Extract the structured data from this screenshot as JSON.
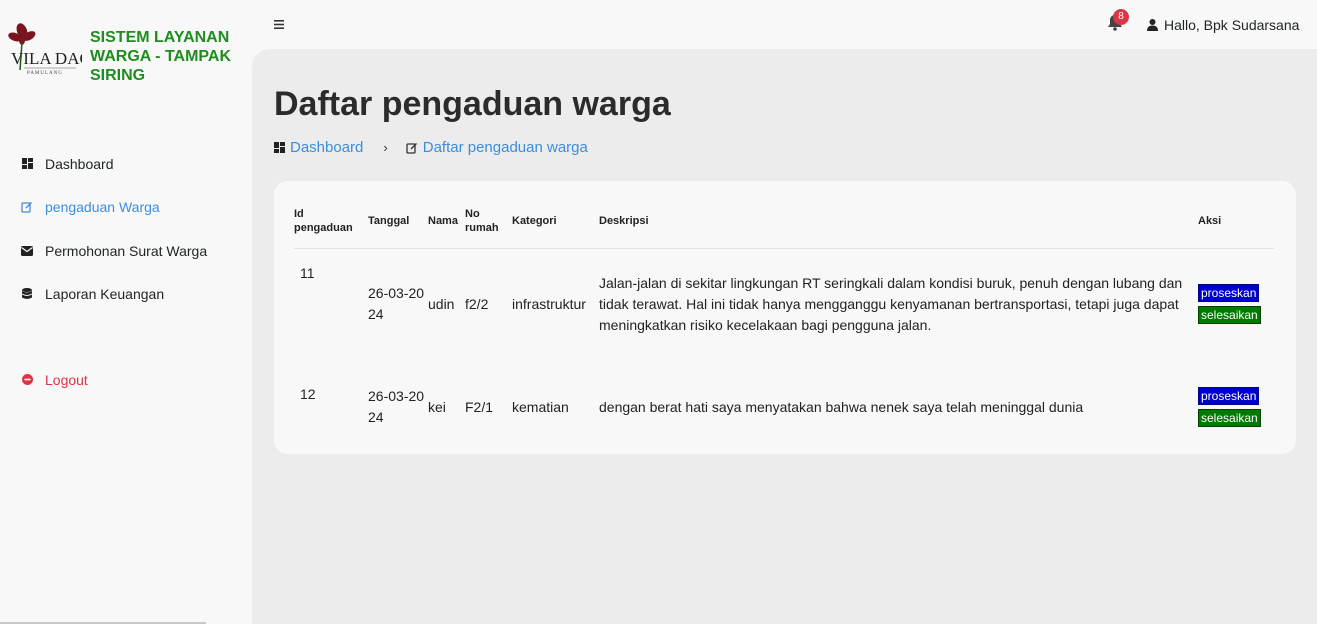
{
  "app": {
    "title": "SISTEM LAYANAN WARGA - TAMPAK SIRING",
    "logo_text": "VILA DAGO",
    "logo_sub": "PAMULANG"
  },
  "sidebar": {
    "items": [
      {
        "label": "Dashboard",
        "icon": "dashboard-icon"
      },
      {
        "label": "pengaduan Warga",
        "icon": "edit-icon",
        "active": true
      },
      {
        "label": "Permohonan Surat Warga",
        "icon": "envelope-icon"
      },
      {
        "label": "Laporan Keuangan",
        "icon": "database-icon"
      }
    ],
    "logout_label": "Logout"
  },
  "topbar": {
    "notification_count": "8",
    "user_greeting": "Hallo, Bpk Sudarsana"
  },
  "page": {
    "title": "Daftar pengaduan warga",
    "breadcrumb": [
      {
        "label": "Dashboard",
        "icon": "dashboard-icon"
      },
      {
        "label": "Daftar pengaduan warga",
        "icon": "edit-icon"
      }
    ]
  },
  "table": {
    "headers": {
      "id_line1": "Id",
      "id_line2": "pengaduan",
      "tanggal": "Tanggal",
      "nama": "Nama",
      "norumah_line1": "No",
      "norumah_line2": "rumah",
      "kategori": "Kategori",
      "deskripsi": "Deskripsi",
      "aksi": "Aksi"
    },
    "rows": [
      {
        "id": "11",
        "tanggal": "26-03-2024",
        "nama": "udin",
        "no_rumah": "f2/2",
        "kategori": "infrastruktur",
        "deskripsi": "Jalan-jalan di sekitar lingkungan RT seringkali dalam kondisi buruk, penuh dengan lubang dan tidak terawat. Hal ini tidak hanya mengganggu kenyamanan bertransportasi, tetapi juga dapat meningkatkan risiko kecelakaan bagi pengguna jalan.",
        "btn_proses": "proseskan",
        "btn_selesai": "selesaikan"
      },
      {
        "id": "12",
        "tanggal": "26-03-2024",
        "nama": "kei",
        "no_rumah": "F2/1",
        "kategori": "kematian",
        "deskripsi": "dengan berat hati saya menyatakan bahwa nenek saya telah meninggal dunia",
        "btn_proses": "proseskan",
        "btn_selesai": "selesaikan"
      }
    ]
  }
}
